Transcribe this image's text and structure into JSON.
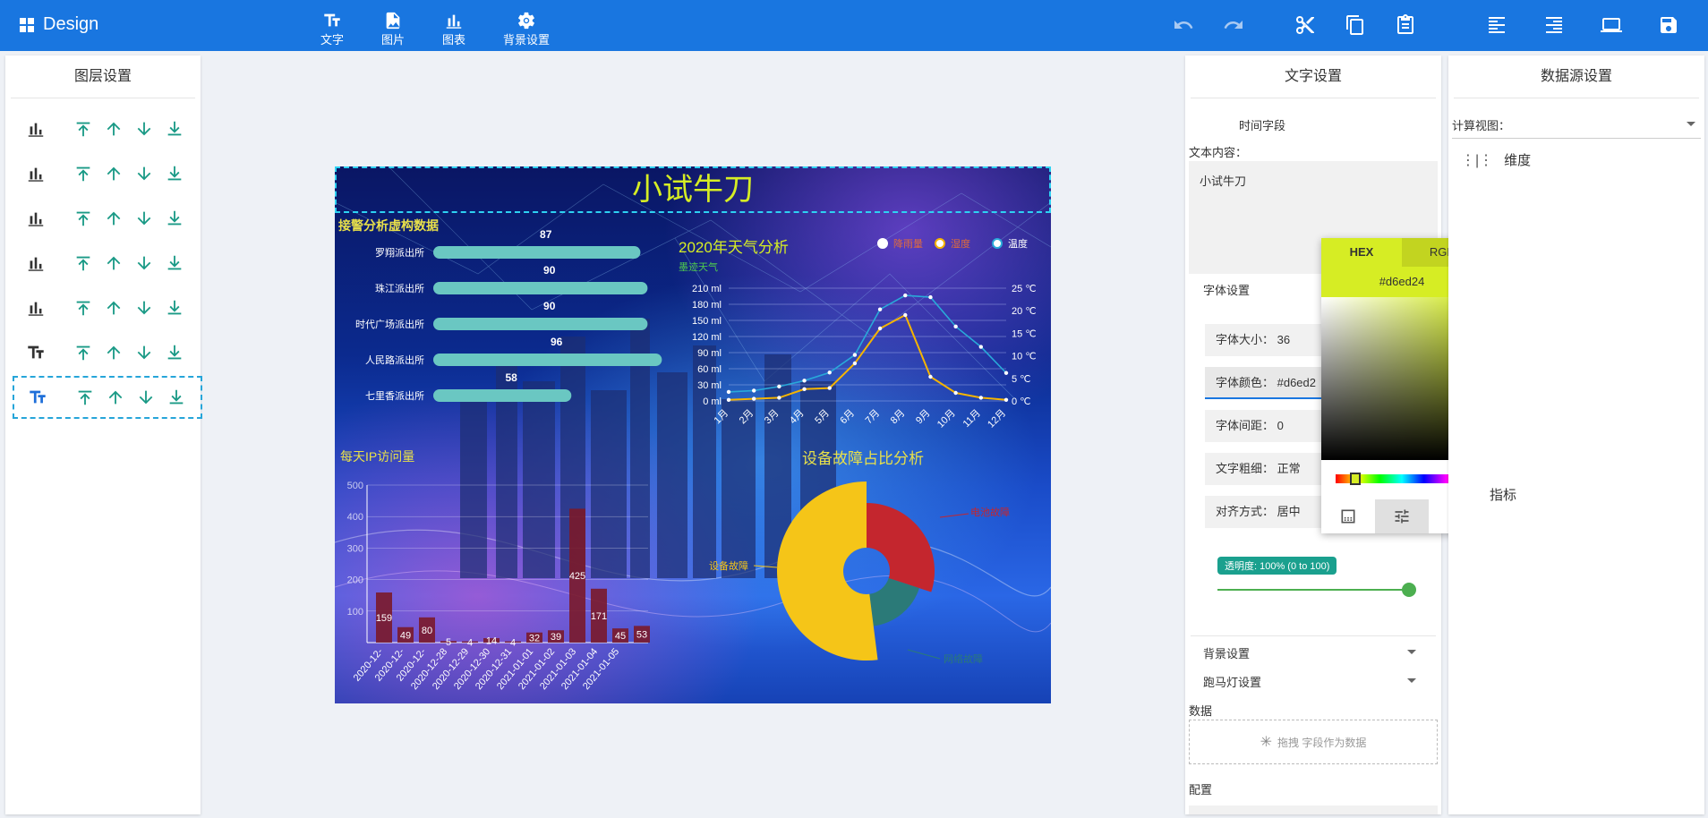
{
  "app": {
    "title": "Design"
  },
  "toolbar": {
    "text_label": "文字",
    "image_label": "图片",
    "chart_label": "图表",
    "bg_label": "背景设置"
  },
  "layers": {
    "title": "图层设置"
  },
  "canvas": {
    "title": "小试牛刀",
    "bar_title": "接警分析虚构数据",
    "line_title": "2020年天气分析",
    "line_subtitle": "墨迹天气",
    "column_title": "每天IP访问量",
    "pie_title": "设备故障占比分析",
    "legend": [
      "降雨量",
      "湿度",
      "温度"
    ],
    "pie_label_left": "设备故障",
    "pie_label_right": "电池故障",
    "pie_label_bottom": "网络故障"
  },
  "chart_data": [
    {
      "type": "bar",
      "title": "接警分析虚构数据",
      "categories": [
        "罗翔派出所",
        "珠江派出所",
        "时代广场派出所",
        "人民路派出所",
        "七里香派出所"
      ],
      "values": [
        87,
        90,
        90,
        96,
        58
      ],
      "color": "#6ac7c2"
    },
    {
      "type": "line",
      "title": "2020年天气分析",
      "subtitle": "墨迹天气",
      "categories": [
        "1月",
        "2月",
        "3月",
        "4月",
        "5月",
        "6月",
        "7月",
        "8月",
        "9月",
        "10月",
        "11月",
        "12月"
      ],
      "y_left_ticks": [
        "0 ml",
        "30 ml",
        "60 ml",
        "90 ml",
        "120 ml",
        "150 ml",
        "180 ml",
        "210 ml"
      ],
      "y_right_ticks": [
        "0 ℃",
        "5 ℃",
        "10 ℃",
        "15 ℃",
        "20 ℃",
        "25 ℃"
      ],
      "series": [
        {
          "name": "降雨量",
          "color": "#e06c3c",
          "values": [
            2,
            4,
            6,
            22,
            24,
            70,
            135,
            160,
            45,
            15,
            6,
            2
          ]
        },
        {
          "name": "湿度",
          "color": "#f5b400",
          "values": [
            2,
            4,
            6,
            22,
            24,
            70,
            135,
            160,
            45,
            15,
            6,
            2
          ]
        },
        {
          "name": "温度",
          "color": "#29a9d9",
          "values": [
            2.0,
            2.3,
            3.2,
            4.5,
            6.3,
            10.2,
            20.3,
            23.4,
            23.0,
            16.5,
            12.0,
            6.2
          ]
        }
      ]
    },
    {
      "type": "bar",
      "title": "每天IP访问量",
      "categories": [
        "2020-12-",
        "2020-12-",
        "2020-12-",
        "2020-12-28",
        "2020-12-29",
        "2020-12-30",
        "2020-12-31",
        "2021-01-01",
        "2021-01-02",
        "2021-01-03",
        "2021-01-04",
        "2021-01-05"
      ],
      "values": [
        159,
        49,
        80,
        5,
        4,
        14,
        4,
        32,
        39,
        425,
        171,
        45,
        53
      ],
      "yticks": [
        100,
        200,
        300,
        400,
        500
      ],
      "color": "#7a1a2a"
    },
    {
      "type": "pie",
      "title": "设备故障占比分析",
      "slices": [
        {
          "name": "设备故障",
          "value": 52,
          "color": "#f5c518"
        },
        {
          "name": "电池故障",
          "value": 30,
          "color": "#c4262e"
        },
        {
          "name": "网络故障",
          "value": 18,
          "color": "#2b7a78"
        }
      ]
    }
  ],
  "text_settings": {
    "title": "文字设置",
    "time_field": "时间字段",
    "content_label": "文本内容：",
    "content_value": "小试牛刀",
    "font_section": "字体设置",
    "font_size": "字体大小：  36",
    "font_color": "字体颜色：  #d6ed2",
    "letter_spacing": "字体间距：  0",
    "font_weight": "文字粗细：  正常",
    "align": "对齐方式：  居中",
    "opacity": "透明度: 100% (0 to 100)",
    "bg_settings": "背景设置",
    "marquee": "跑马灯设置",
    "data_label": "数据",
    "data_drop": "拖拽 字段作为数据",
    "config_label": "配置"
  },
  "color_picker": {
    "tab_hex": "HEX",
    "tab_rgb": "RGB",
    "hex": "#d6ed24"
  },
  "data_source": {
    "title": "数据源设置",
    "view_label": "计算视图：",
    "dimension": "维度",
    "metric": "指标"
  }
}
